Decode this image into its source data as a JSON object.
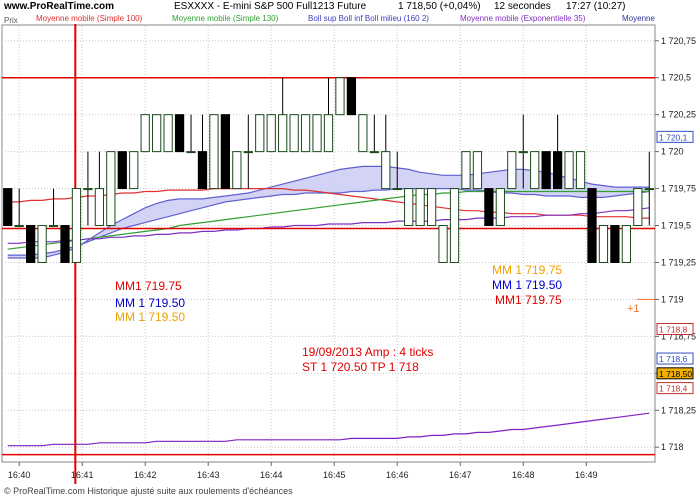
{
  "header": {
    "site": "www.ProRealTime.com",
    "instrument": "ESXXXX - E-mini S&P 500 Full1213 Future",
    "price_change": "1 718,50 (+0,04%)",
    "interval": "12 secondes",
    "time": "17:27 (10:27)",
    "legend": [
      {
        "label": "Moyenne mobile (Simple 100)",
        "color": "#e03030"
      },
      {
        "label": "Moyenne mobile (Simple 130)",
        "color": "#30a030"
      },
      {
        "label": "Boll sup Boll inf Boll milieu (160 2)",
        "color": "#4040c0"
      },
      {
        "label": "Moyenne mobile (Exponentielle 35)",
        "color": "#8030c0"
      },
      {
        "label": "Moyenne",
        "color": "#3030a0"
      }
    ]
  },
  "prix_label": "Prix",
  "footer": "© ProRealTime.com Historique ajusté suite aux roulements d'échéances",
  "annotations": {
    "left_mm1": "MM1 719.75",
    "left_mm_blue": "MM 1 719.50",
    "left_mm_orange": "MM 1 719.50",
    "right_mm_orange": "MM 1 719.75",
    "right_mm_blue": "MM 1 719.50",
    "right_mm1": "MM1 719.75",
    "date_amp": "19/09/2013   Amp : 4 ticks",
    "st_tp": "ST 1 720.50  TP 1 718",
    "plus1": "+1"
  },
  "colors": {
    "red": "#e00000",
    "blue": "#0000d0",
    "orange": "#f0a000",
    "band_fill": "#c8c8f4"
  },
  "chart_data": {
    "type": "candlestick",
    "xlabel": "",
    "ylabel": "",
    "ylim": [
      1717.9,
      1720.85
    ],
    "y_ticks": [
      "1 720,75",
      "1 720,5",
      "1 720,25",
      "1 720",
      "1 719,75",
      "1 719,5",
      "1 719,25",
      "1 719",
      "1 718,75",
      "1 718,5",
      "1 718,25",
      "1 718"
    ],
    "y_tick_values": [
      1720.75,
      1720.5,
      1720.25,
      1720,
      1719.75,
      1719.5,
      1719.25,
      1719,
      1718.75,
      1718.5,
      1718.25,
      1718
    ],
    "x_ticks": [
      "16:40",
      "16:41",
      "16:42",
      "16:43",
      "16:44",
      "16:45",
      "16:46",
      "16:47",
      "16:48",
      "16:49"
    ],
    "x_tick_slots": [
      1,
      6.5,
      12,
      17.5,
      23,
      28.5,
      34,
      39.5,
      45,
      50.5
    ],
    "candles": [
      {
        "o": 1719.75,
        "h": 1719.75,
        "l": 1719.5,
        "c": 1719.5,
        "bull": false
      },
      {
        "o": 1719.5,
        "h": 1719.75,
        "l": 1719.5,
        "c": 1719.5,
        "bull": true
      },
      {
        "o": 1719.5,
        "h": 1719.5,
        "l": 1719.25,
        "c": 1719.25,
        "bull": false
      },
      {
        "o": 1719.25,
        "h": 1719.5,
        "l": 1719.25,
        "c": 1719.5,
        "bull": true
      },
      {
        "o": 1719.5,
        "h": 1719.75,
        "l": 1719.5,
        "c": 1719.5,
        "bull": true
      },
      {
        "o": 1719.5,
        "h": 1719.5,
        "l": 1719.25,
        "c": 1719.25,
        "bull": false
      },
      {
        "o": 1719.25,
        "h": 1719.75,
        "l": 1719.25,
        "c": 1719.75,
        "bull": true
      },
      {
        "o": 1719.75,
        "h": 1720.0,
        "l": 1719.5,
        "c": 1719.75,
        "bull": true
      },
      {
        "o": 1719.75,
        "h": 1720.0,
        "l": 1719.5,
        "c": 1719.5,
        "bull": true
      },
      {
        "o": 1719.5,
        "h": 1720.0,
        "l": 1719.5,
        "c": 1720.0,
        "bull": true
      },
      {
        "o": 1720.0,
        "h": 1720.0,
        "l": 1719.75,
        "c": 1719.75,
        "bull": false
      },
      {
        "o": 1719.75,
        "h": 1720.0,
        "l": 1719.75,
        "c": 1720.0,
        "bull": true
      },
      {
        "o": 1720.0,
        "h": 1720.25,
        "l": 1720.0,
        "c": 1720.25,
        "bull": true
      },
      {
        "o": 1720.25,
        "h": 1720.25,
        "l": 1720.0,
        "c": 1720.0,
        "bull": true
      },
      {
        "o": 1720.0,
        "h": 1720.25,
        "l": 1720.0,
        "c": 1720.25,
        "bull": true
      },
      {
        "o": 1720.25,
        "h": 1720.25,
        "l": 1720.0,
        "c": 1720.0,
        "bull": false
      },
      {
        "o": 1720.0,
        "h": 1720.25,
        "l": 1720.0,
        "c": 1720.0,
        "bull": true
      },
      {
        "o": 1720.0,
        "h": 1720.25,
        "l": 1719.75,
        "c": 1719.75,
        "bull": false
      },
      {
        "o": 1719.75,
        "h": 1720.25,
        "l": 1719.75,
        "c": 1720.25,
        "bull": true
      },
      {
        "o": 1720.25,
        "h": 1720.25,
        "l": 1719.75,
        "c": 1719.75,
        "bull": false
      },
      {
        "o": 1719.75,
        "h": 1720.0,
        "l": 1719.75,
        "c": 1720.0,
        "bull": true
      },
      {
        "o": 1720.0,
        "h": 1720.25,
        "l": 1719.75,
        "c": 1720.0,
        "bull": true
      },
      {
        "o": 1720.0,
        "h": 1720.25,
        "l": 1720.0,
        "c": 1720.25,
        "bull": true
      },
      {
        "o": 1720.25,
        "h": 1720.25,
        "l": 1720.0,
        "c": 1720.0,
        "bull": true
      },
      {
        "o": 1720.0,
        "h": 1720.5,
        "l": 1720.0,
        "c": 1720.25,
        "bull": true
      },
      {
        "o": 1720.25,
        "h": 1720.25,
        "l": 1720.0,
        "c": 1720.0,
        "bull": true
      },
      {
        "o": 1720.0,
        "h": 1720.25,
        "l": 1720.0,
        "c": 1720.25,
        "bull": true
      },
      {
        "o": 1720.25,
        "h": 1720.25,
        "l": 1720.0,
        "c": 1720.0,
        "bull": true
      },
      {
        "o": 1720.0,
        "h": 1720.5,
        "l": 1720.0,
        "c": 1720.25,
        "bull": true
      },
      {
        "o": 1720.25,
        "h": 1720.5,
        "l": 1720.25,
        "c": 1720.5,
        "bull": true
      },
      {
        "o": 1720.5,
        "h": 1720.5,
        "l": 1720.25,
        "c": 1720.25,
        "bull": false
      },
      {
        "o": 1720.25,
        "h": 1720.25,
        "l": 1720.0,
        "c": 1720.0,
        "bull": true
      },
      {
        "o": 1720.0,
        "h": 1720.25,
        "l": 1720.0,
        "c": 1720.0,
        "bull": true
      },
      {
        "o": 1720.0,
        "h": 1720.25,
        "l": 1719.75,
        "c": 1719.75,
        "bull": true
      },
      {
        "o": 1719.75,
        "h": 1720.0,
        "l": 1719.75,
        "c": 1719.75,
        "bull": true
      },
      {
        "o": 1719.75,
        "h": 1719.75,
        "l": 1719.5,
        "c": 1719.5,
        "bull": true
      },
      {
        "o": 1719.5,
        "h": 1719.75,
        "l": 1719.5,
        "c": 1719.75,
        "bull": true
      },
      {
        "o": 1719.75,
        "h": 1719.75,
        "l": 1719.5,
        "c": 1719.5,
        "bull": true
      },
      {
        "o": 1719.5,
        "h": 1719.5,
        "l": 1719.25,
        "c": 1719.25,
        "bull": true
      },
      {
        "o": 1719.25,
        "h": 1719.75,
        "l": 1719.25,
        "c": 1719.75,
        "bull": true
      },
      {
        "o": 1719.75,
        "h": 1720.0,
        "l": 1719.75,
        "c": 1720.0,
        "bull": true
      },
      {
        "o": 1720.0,
        "h": 1720.0,
        "l": 1719.75,
        "c": 1719.75,
        "bull": true
      },
      {
        "o": 1719.75,
        "h": 1719.75,
        "l": 1719.5,
        "c": 1719.5,
        "bull": false
      },
      {
        "o": 1719.5,
        "h": 1719.75,
        "l": 1719.5,
        "c": 1719.75,
        "bull": true
      },
      {
        "o": 1719.75,
        "h": 1720.0,
        "l": 1719.75,
        "c": 1720.0,
        "bull": true
      },
      {
        "o": 1720.0,
        "h": 1720.25,
        "l": 1719.75,
        "c": 1720.0,
        "bull": true
      },
      {
        "o": 1720.0,
        "h": 1720.0,
        "l": 1719.75,
        "c": 1719.75,
        "bull": true
      },
      {
        "o": 1719.75,
        "h": 1720.0,
        "l": 1719.75,
        "c": 1720.0,
        "bull": false
      },
      {
        "o": 1720.0,
        "h": 1720.25,
        "l": 1719.75,
        "c": 1719.75,
        "bull": false
      },
      {
        "o": 1719.75,
        "h": 1720.0,
        "l": 1719.75,
        "c": 1720.0,
        "bull": true
      },
      {
        "o": 1720.0,
        "h": 1720.0,
        "l": 1719.75,
        "c": 1719.75,
        "bull": true
      },
      {
        "o": 1719.75,
        "h": 1719.75,
        "l": 1719.25,
        "c": 1719.25,
        "bull": false
      },
      {
        "o": 1719.25,
        "h": 1719.5,
        "l": 1719.25,
        "c": 1719.5,
        "bull": true
      },
      {
        "o": 1719.5,
        "h": 1719.5,
        "l": 1719.25,
        "c": 1719.25,
        "bull": false
      },
      {
        "o": 1719.25,
        "h": 1719.5,
        "l": 1719.25,
        "c": 1719.5,
        "bull": true
      },
      {
        "o": 1719.5,
        "h": 1719.75,
        "l": 1719.5,
        "c": 1719.75,
        "bull": true
      },
      {
        "o": 1719.75,
        "h": 1720.0,
        "l": 1719.5,
        "c": 1719.75,
        "bull": true
      }
    ],
    "series": [
      {
        "kind": "boll_sup",
        "color": "#6060d0",
        "values": [
          1719.28,
          1719.28,
          1719.28,
          1719.28,
          1719.3,
          1719.32,
          1719.35,
          1719.4,
          1719.45,
          1719.5,
          1719.54,
          1719.58,
          1719.62,
          1719.65,
          1719.67,
          1719.68,
          1719.68,
          1719.68,
          1719.69,
          1719.7,
          1719.71,
          1719.72,
          1719.74,
          1719.76,
          1719.78,
          1719.8,
          1719.82,
          1719.84,
          1719.86,
          1719.88,
          1719.89,
          1719.9,
          1719.9,
          1719.9,
          1719.89,
          1719.88,
          1719.86,
          1719.85,
          1719.84,
          1719.84,
          1719.84,
          1719.85,
          1719.86,
          1719.87,
          1719.88,
          1719.88,
          1719.87,
          1719.86,
          1719.84,
          1719.82,
          1719.8,
          1719.78,
          1719.77,
          1719.76,
          1719.76,
          1719.76,
          1719.76
        ]
      },
      {
        "kind": "boll_inf",
        "color": "#6060d0",
        "values": [
          1719.3,
          1719.3,
          1719.3,
          1719.31,
          1719.32,
          1719.34,
          1719.36,
          1719.39,
          1719.42,
          1719.45,
          1719.48,
          1719.5,
          1719.52,
          1719.54,
          1719.56,
          1719.58,
          1719.6,
          1719.62,
          1719.64,
          1719.66,
          1719.67,
          1719.68,
          1719.69,
          1719.7,
          1719.71,
          1719.71,
          1719.72,
          1719.72,
          1719.72,
          1719.72,
          1719.73,
          1719.73,
          1719.74,
          1719.74,
          1719.75,
          1719.75,
          1719.75,
          1719.75,
          1719.75,
          1719.75,
          1719.74,
          1719.74,
          1719.73,
          1719.72,
          1719.72,
          1719.71,
          1719.71,
          1719.7,
          1719.7,
          1719.7,
          1719.69,
          1719.69,
          1719.69,
          1719.7,
          1719.71,
          1719.72,
          1719.73
        ]
      },
      {
        "kind": "sma100",
        "color": "#e03030",
        "values": [
          1719.66,
          1719.66,
          1719.67,
          1719.67,
          1719.68,
          1719.68,
          1719.69,
          1719.7,
          1719.7,
          1719.71,
          1719.72,
          1719.72,
          1719.73,
          1719.73,
          1719.74,
          1719.74,
          1719.74,
          1719.74,
          1719.75,
          1719.75,
          1719.75,
          1719.75,
          1719.75,
          1719.75,
          1719.75,
          1719.74,
          1719.74,
          1719.73,
          1719.72,
          1719.71,
          1719.7,
          1719.69,
          1719.68,
          1719.67,
          1719.66,
          1719.65,
          1719.64,
          1719.63,
          1719.62,
          1719.61,
          1719.6,
          1719.6,
          1719.59,
          1719.59,
          1719.58,
          1719.58,
          1719.58,
          1719.57,
          1719.57,
          1719.57,
          1719.57,
          1719.56,
          1719.56,
          1719.56,
          1719.56,
          1719.55,
          1719.55
        ]
      },
      {
        "kind": "sma130",
        "color": "#30a030",
        "values": [
          1719.34,
          1719.35,
          1719.36,
          1719.37,
          1719.38,
          1719.39,
          1719.4,
          1719.41,
          1719.42,
          1719.43,
          1719.44,
          1719.45,
          1719.46,
          1719.47,
          1719.48,
          1719.5,
          1719.51,
          1719.52,
          1719.53,
          1719.54,
          1719.55,
          1719.56,
          1719.57,
          1719.58,
          1719.59,
          1719.6,
          1719.61,
          1719.62,
          1719.63,
          1719.64,
          1719.65,
          1719.66,
          1719.67,
          1719.68,
          1719.69,
          1719.7,
          1719.71,
          1719.71,
          1719.72,
          1719.72,
          1719.73,
          1719.73,
          1719.73,
          1719.73,
          1719.73,
          1719.73,
          1719.73,
          1719.73,
          1719.73,
          1719.73,
          1719.73,
          1719.73,
          1719.73,
          1719.73,
          1719.73,
          1719.73,
          1719.73
        ]
      },
      {
        "kind": "ema35",
        "color": "#8030c0",
        "values": [
          1719.38,
          1719.38,
          1719.39,
          1719.39,
          1719.39,
          1719.4,
          1719.4,
          1719.41,
          1719.41,
          1719.42,
          1719.42,
          1719.43,
          1719.43,
          1719.44,
          1719.44,
          1719.45,
          1719.45,
          1719.46,
          1719.46,
          1719.47,
          1719.47,
          1719.48,
          1719.48,
          1719.49,
          1719.49,
          1719.5,
          1719.5,
          1719.5,
          1719.51,
          1719.51,
          1719.51,
          1719.52,
          1719.52,
          1719.52,
          1719.53,
          1719.53,
          1719.53,
          1719.53,
          1719.54,
          1719.54,
          1719.54,
          1719.55,
          1719.55,
          1719.55,
          1719.56,
          1719.56,
          1719.56,
          1719.57,
          1719.57,
          1719.57,
          1719.58,
          1719.58,
          1719.59,
          1719.6,
          1719.6,
          1719.61,
          1719.62
        ]
      },
      {
        "kind": "lower_ma",
        "color": "#8020c0",
        "values": [
          1718.01,
          1718.01,
          1718.01,
          1718.01,
          1718.02,
          1718.02,
          1718.02,
          1718.02,
          1718.03,
          1718.03,
          1718.03,
          1718.03,
          1718.03,
          1718.04,
          1718.04,
          1718.04,
          1718.04,
          1718.04,
          1718.04,
          1718.04,
          1718.05,
          1718.05,
          1718.05,
          1718.05,
          1718.05,
          1718.05,
          1718.05,
          1718.05,
          1718.05,
          1718.05,
          1718.06,
          1718.06,
          1718.06,
          1718.06,
          1718.06,
          1718.07,
          1718.07,
          1718.08,
          1718.08,
          1718.09,
          1718.09,
          1718.1,
          1718.1,
          1718.11,
          1718.12,
          1718.12,
          1718.13,
          1718.14,
          1718.15,
          1718.16,
          1718.17,
          1718.18,
          1718.19,
          1718.2,
          1718.21,
          1718.22,
          1718.23
        ]
      }
    ],
    "levels": [
      {
        "value": 1720.5,
        "color": "#e00000"
      },
      {
        "value": 1719.48,
        "color": "#e00000"
      },
      {
        "value": 1717.95,
        "color": "#e00000"
      }
    ],
    "vertical_line_slot": 6,
    "right_labels": [
      {
        "text": "1 720,1",
        "value": 1720.1,
        "color": "#3050c0"
      },
      {
        "text": "1 718,8",
        "value": 1718.8,
        "color": "#c03030"
      },
      {
        "text": "1 718,6",
        "value": 1718.6,
        "color": "#3050c0"
      },
      {
        "text": "1 718,50",
        "value": 1718.5,
        "color": "#000000",
        "bg": "#f0b000"
      },
      {
        "text": "1 718,4",
        "value": 1718.4,
        "color": "#c03030"
      }
    ]
  }
}
